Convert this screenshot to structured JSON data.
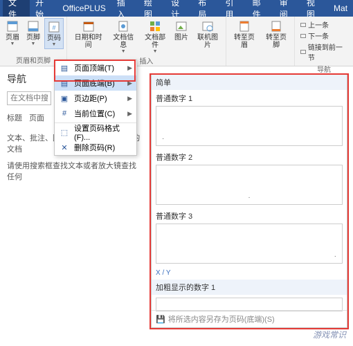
{
  "tabs": {
    "file": "文件",
    "home": "开始",
    "officeplus": "OfficePLUS",
    "insert": "插入",
    "draw": "绘图",
    "design": "设计",
    "layout": "布局",
    "references": "引用",
    "mail": "邮件",
    "review": "审阅",
    "view": "视图",
    "mat": "Mat"
  },
  "ribbon": {
    "header": "页眉",
    "footer": "页脚",
    "page_number": "页码",
    "group_hf": "页眉和页脚",
    "date_time": "日期和时间",
    "doc_info": "文档信息",
    "doc_parts": "文档部件",
    "pictures": "图片",
    "online_pic": "联机图片",
    "group_insert": "插入",
    "goto_header": "转至页眉",
    "goto_footer": "转至页脚",
    "nav_prev": "上一条",
    "nav_next": "下一条",
    "nav_link": "链接到前一节",
    "group_nav": "导航"
  },
  "dropdown": {
    "top": "页面顶端(T)",
    "bottom": "页面底端(B)",
    "margins": "页边距(P)",
    "current": "当前位置(C)",
    "format": "设置页码格式(F)...",
    "remove": "删除页码(R)"
  },
  "gallery": {
    "cat_simple": "简单",
    "opt1": "普通数字 1",
    "opt2": "普通数字 2",
    "opt3": "普通数字 3",
    "xy": "X / Y",
    "cat_bold": "加粗显示的数字 1",
    "save": "将所选内容另存为页码(底端)(S)"
  },
  "nav": {
    "title": "导航",
    "search_placeholder": "在文档中搜索",
    "tab_heading": "标题",
    "tab_page": "页面",
    "desc1": "文本、批注、图片...Word 可以查找您的文档",
    "desc2": "请使用搜索框查找文本或者放大镜查找任何"
  },
  "watermark": "游戏常识"
}
